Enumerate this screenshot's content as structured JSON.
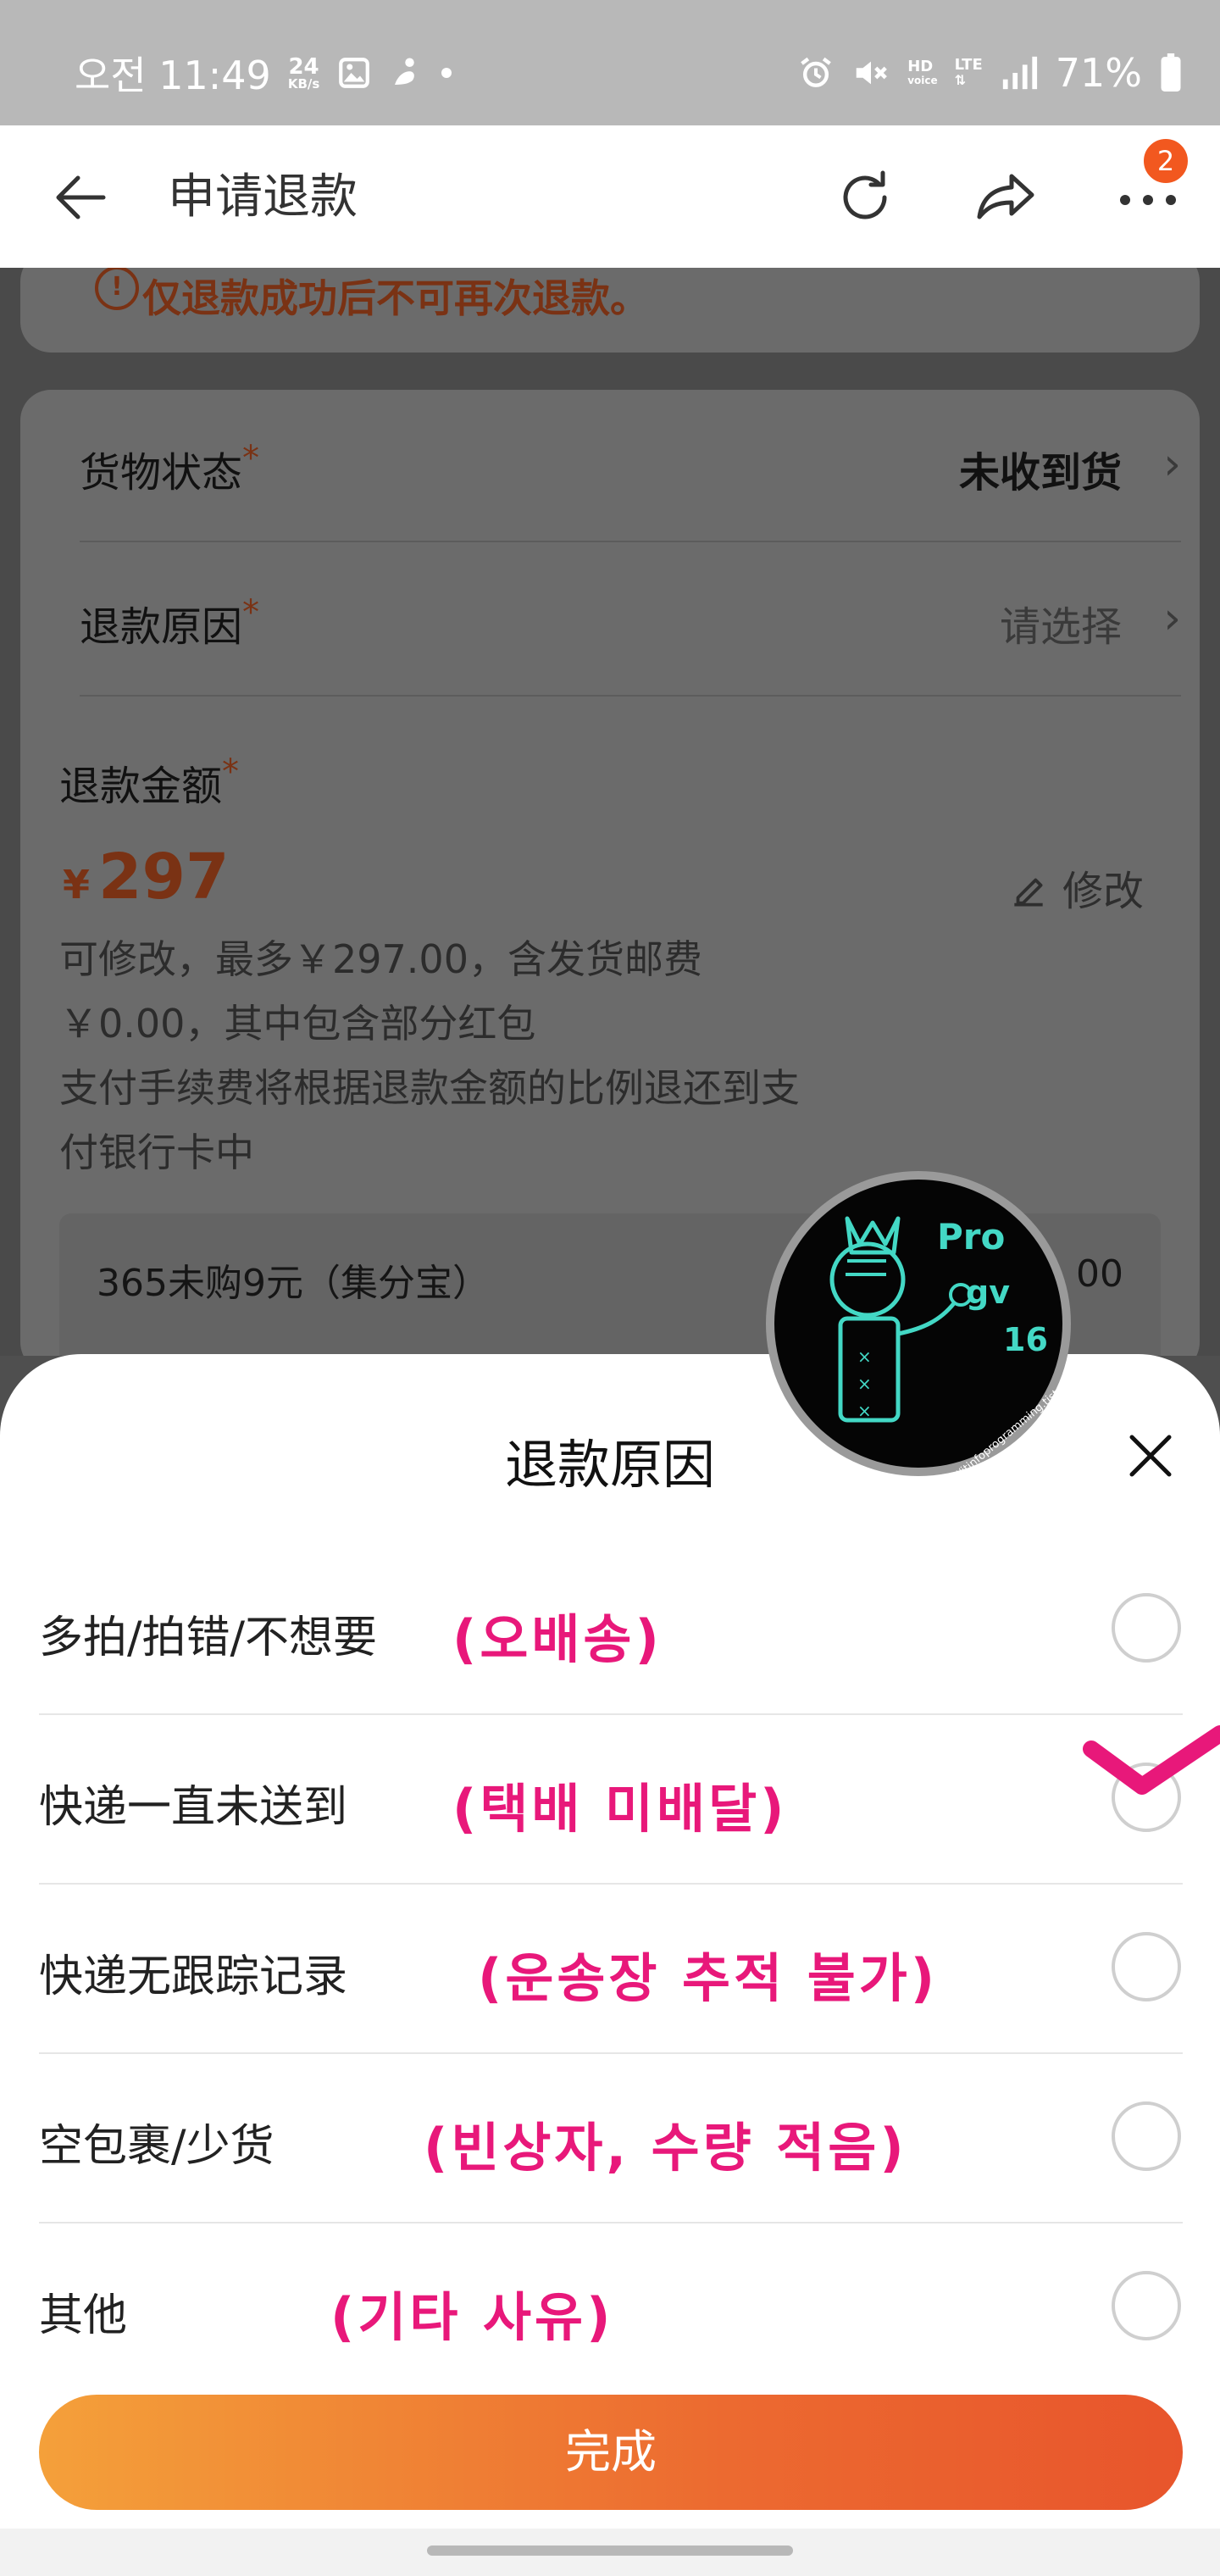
{
  "status_bar": {
    "time": "오전 11:49",
    "net_speed": "24",
    "net_unit": "KB/s",
    "hd_label": "HD",
    "voice_label": "voice",
    "lte_label": "LTE",
    "battery": "71%"
  },
  "nav": {
    "title": "申请退款",
    "badge_count": "2"
  },
  "notice": {
    "icon_glyph": "!",
    "text": "仅退款成功后不可再次退款。"
  },
  "form": {
    "goods_status": {
      "label": "货物状态",
      "required": "*",
      "value": "未收到货",
      "chevron": "›"
    },
    "refund_reason": {
      "label": "退款原因",
      "required": "*",
      "value": "请选择",
      "chevron": "›"
    },
    "refund_amount": {
      "label": "退款金额",
      "required": "*",
      "currency": "¥",
      "value": "297",
      "edit_label": "修改",
      "desc_lines": [
        "可修改，最多￥297.00，含发货邮费",
        "￥0.00，其中包含部分红包",
        "支付手续费将根据退款金额的比例退还到支",
        "付银行卡中"
      ]
    },
    "promo": {
      "text": "365未购9元（集分宝）",
      "amount": "00"
    }
  },
  "logo": {
    "line1": "Pro",
    "line2": "gv",
    "line3": "16",
    "url": "https://itinfoprogramming.tistory.com"
  },
  "sheet": {
    "title": "退款原因",
    "options": [
      {
        "label": "多拍/拍错/不想要",
        "note": "(오배송)"
      },
      {
        "label": "快递一直未送到",
        "note": "(택배 미배달)"
      },
      {
        "label": "快递无跟踪记录",
        "note": "(운송장 추적 불가)"
      },
      {
        "label": "空包裹/少货",
        "note": "(빈상자, 수량 적음)"
      },
      {
        "label": "其他",
        "note": "(기타 사유)"
      }
    ],
    "done_label": "完成"
  },
  "colors": {
    "accent_orange": "#ec6a30",
    "annotation_pink": "#e8187a",
    "price_color": "#7a3214"
  }
}
